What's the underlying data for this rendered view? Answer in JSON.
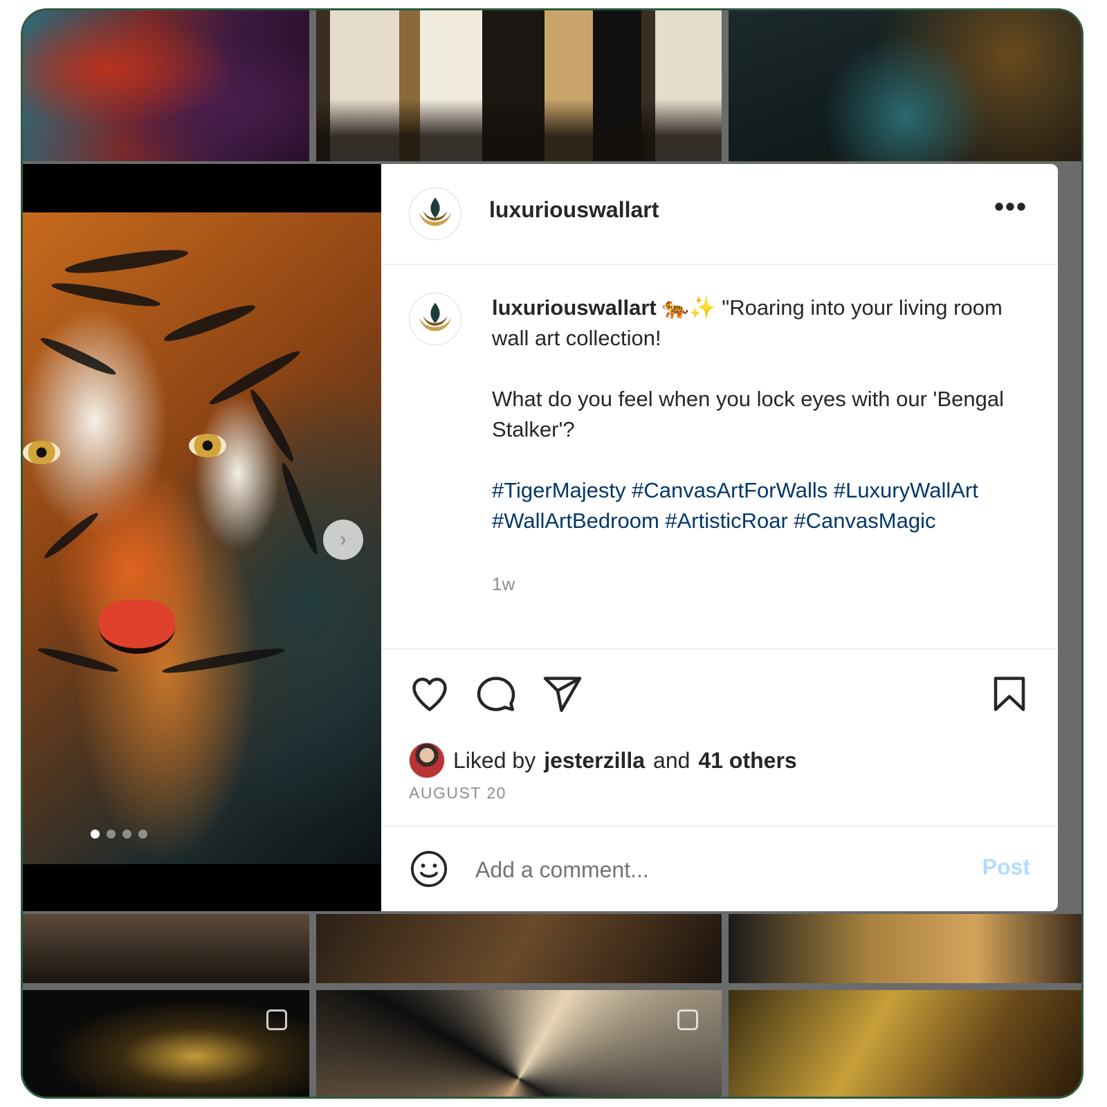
{
  "post": {
    "username": "luxuriouswallart",
    "caption_username": "luxuriouswallart",
    "caption_emoji": "🐅✨",
    "caption_line1": "\"Roaring into your living room wall art collection!",
    "caption_line2": "What do you feel when you lock eyes with our 'Bengal Stalker'?",
    "hashtags": "#TigerMajesty #CanvasArtForWalls #LuxuryWallArt #WallArtBedroom #ArtisticRoar #CanvasMagic",
    "time_ago": "1w",
    "likes": {
      "prefix": "Liked by",
      "user": "jesterzilla",
      "middle": "and",
      "others": "41 others"
    },
    "date": "AUGUST 20",
    "more_label": "•••"
  },
  "comment": {
    "placeholder": "Add a comment...",
    "post_label": "Post"
  },
  "carousel": {
    "next_label": "›",
    "slide_count": 4,
    "active_slide": 1
  },
  "icons": [
    "more-icon",
    "heart-icon",
    "comment-icon",
    "share-icon",
    "bookmark-icon",
    "emoji-icon",
    "chevron-right-icon"
  ],
  "colors": {
    "frame_border": "#2d5a3a",
    "hashtag": "#00376b",
    "post_button": "#b3dbff",
    "muted_text": "#8e8e8e"
  }
}
